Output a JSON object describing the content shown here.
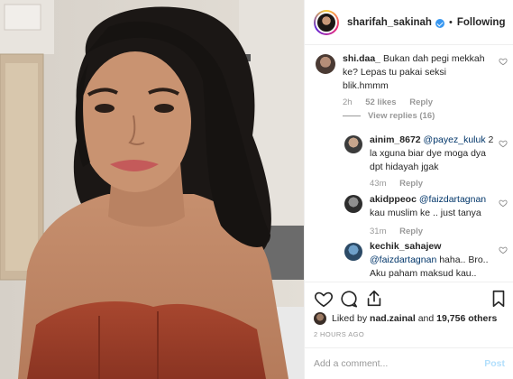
{
  "post": {
    "username": "sharifah_sakinah",
    "separator": "•",
    "follow_label": "Following"
  },
  "comments": [
    {
      "user": "shi.daa_",
      "text": "Bukan dah pegi mekkah ke? Lepas tu pakai seksi blik.hmmm",
      "time": "2h",
      "likes": "52 likes",
      "reply": "Reply",
      "view_replies": "View replies (16)"
    },
    {
      "user": "ainim_8672",
      "mention": "@payez_kuluk",
      "text": "2 la xguna biar dye moga dya dpt hidayah jgak",
      "time": "43m",
      "reply": "Reply"
    },
    {
      "user": "akidppeoc",
      "mention": "@faizdartagnan",
      "text": "kau muslim ke .. just tanya",
      "time": "31m",
      "reply": "Reply"
    },
    {
      "user": "kechik_sahajew",
      "mention": "@faizdartagnan",
      "text": "haha.. Bro.. Aku paham maksud kau..",
      "time": "",
      "reply": ""
    }
  ],
  "likes": {
    "prefix": "Liked by",
    "user": "nad.zainal",
    "conjunction": "and",
    "others": "19,756 others"
  },
  "time_ago": "2 HOURS AGO",
  "add_comment": {
    "placeholder": "Add a comment...",
    "post_label": "Post"
  },
  "icons": {
    "like": "heart-icon",
    "comment": "comment-icon",
    "share": "share-icon",
    "save": "bookmark-icon"
  },
  "colors": {
    "verified": "#3897f0",
    "muted_text": "#999999",
    "post_disabled": "#b2dffc",
    "mention": "#003569"
  }
}
